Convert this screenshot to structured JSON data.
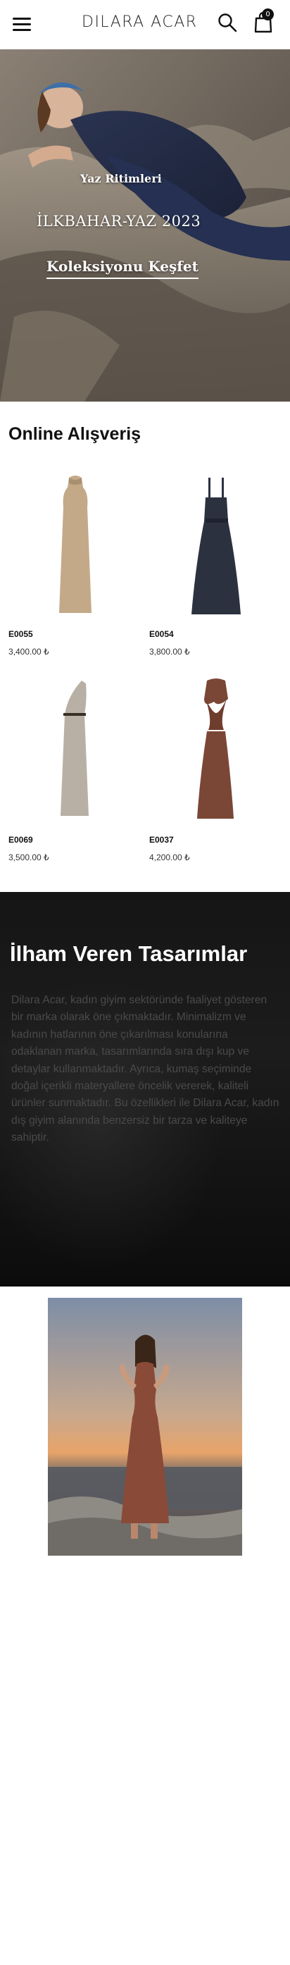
{
  "header": {
    "brand": "DILARA ACAR",
    "cart_count": "0",
    "icons": [
      "hamburger-menu-icon",
      "search-icon",
      "shopping-bag-icon"
    ]
  },
  "hero": {
    "kicker": "Yaz Ritimleri",
    "title": "İLKBAHAR-YAZ 2023",
    "cta": "Koleksiyonu Keşfet"
  },
  "shop": {
    "title": "Online Alışveriş",
    "products": [
      {
        "code": "E0055",
        "price": "3,400.00 ₺",
        "color": "#c4a988"
      },
      {
        "code": "E0054",
        "price": "3,800.00 ₺",
        "color": "#2c3140"
      },
      {
        "code": "E0069",
        "price": "3,500.00 ₺",
        "color": "#b8b0a4"
      },
      {
        "code": "E0037",
        "price": "4,200.00 ₺",
        "color": "#7a4635"
      }
    ]
  },
  "inspire": {
    "title": "İlham Veren Tasarımlar",
    "text": "Dilara Acar, kadın giyim sektöründe faaliyet gösteren bir marka olarak öne çıkmaktadır. Minimalizm ve kadının hatlarının öne çıkarılması konularına odaklanan marka, tasarımlarında sıra dışı kup ve detaylar kullanmaktadır. Ayrıca, kumaş seçiminde doğal içerikli materyallere öncelik vererek, kaliteli ürünler sunmaktadır. Bu özellikleri ile Dilara Acar, kadın dış giyim alanında benzersiz bir tarza ve kaliteye sahiptir."
  }
}
